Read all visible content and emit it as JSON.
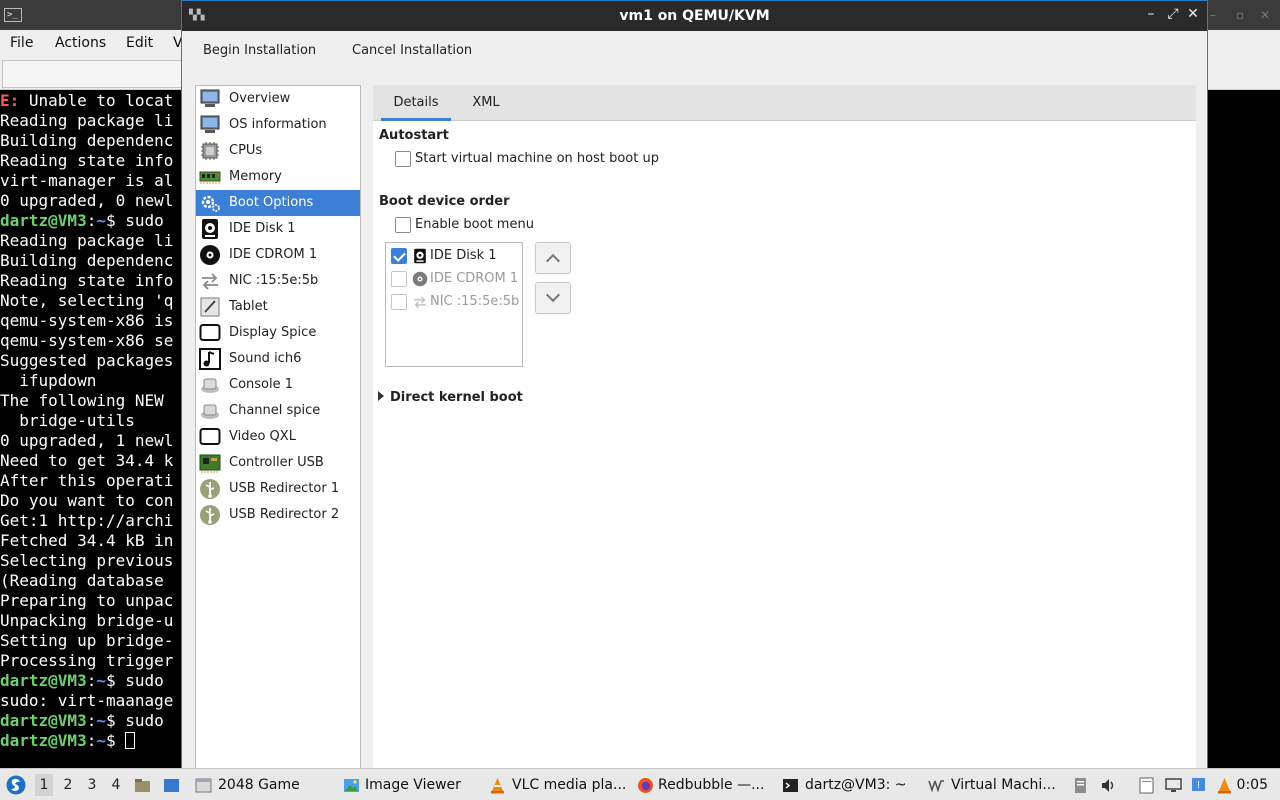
{
  "terminal": {
    "menu": [
      "File",
      "Actions",
      "Edit",
      "V"
    ],
    "lines": [
      [
        {
          "t": "E: ",
          "c": "red"
        },
        {
          "t": "Unable to locat"
        }
      ],
      [
        {
          "t": "Reading package li"
        }
      ],
      [
        {
          "t": "Building dependenc"
        }
      ],
      [
        {
          "t": "Reading state info"
        }
      ],
      [
        {
          "t": "virt-manager is al"
        }
      ],
      [
        {
          "t": "0 upgraded, 0 newl"
        }
      ],
      [
        {
          "t": "dartz@VM3",
          "c": "green"
        },
        {
          "t": ":"
        },
        {
          "t": "~",
          "c": "blue"
        },
        {
          "t": "$ sudo "
        }
      ],
      [
        {
          "t": "Reading package li"
        }
      ],
      [
        {
          "t": "Building dependenc"
        }
      ],
      [
        {
          "t": "Reading state info"
        }
      ],
      [
        {
          "t": "Note, selecting 'q"
        }
      ],
      [
        {
          "t": "qemu-system-x86 is"
        }
      ],
      [
        {
          "t": "qemu-system-x86 se"
        }
      ],
      [
        {
          "t": "Suggested packages"
        }
      ],
      [
        {
          "t": "  ifupdown"
        }
      ],
      [
        {
          "t": "The following NEW "
        }
      ],
      [
        {
          "t": "  bridge-utils"
        }
      ],
      [
        {
          "t": "0 upgraded, 1 newl"
        }
      ],
      [
        {
          "t": "Need to get 34.4 k"
        }
      ],
      [
        {
          "t": "After this operati"
        }
      ],
      [
        {
          "t": "Do you want to con"
        }
      ],
      [
        {
          "t": "Get:1 http://archi"
        }
      ],
      [
        {
          "t": "Fetched 34.4 kB in"
        }
      ],
      [
        {
          "t": "Selecting previous"
        }
      ],
      [
        {
          "t": "(Reading database "
        }
      ],
      [
        {
          "t": "Preparing to unpac"
        }
      ],
      [
        {
          "t": "Unpacking bridge-u"
        }
      ],
      [
        {
          "t": "Setting up bridge-"
        }
      ],
      [
        {
          "t": "Processing trigger"
        }
      ],
      [
        {
          "t": "dartz@VM3",
          "c": "green"
        },
        {
          "t": ":"
        },
        {
          "t": "~",
          "c": "blue"
        },
        {
          "t": "$ sudo "
        }
      ],
      [
        {
          "t": "sudo: virt-maanage"
        }
      ],
      [
        {
          "t": "dartz@VM3",
          "c": "green"
        },
        {
          "t": ":"
        },
        {
          "t": "~",
          "c": "blue"
        },
        {
          "t": "$ sudo "
        }
      ],
      [
        {
          "t": "dartz@VM3",
          "c": "green"
        },
        {
          "t": ":"
        },
        {
          "t": "~",
          "c": "blue"
        },
        {
          "t": "$ "
        },
        {
          "t": "",
          "c": "cursor"
        }
      ]
    ]
  },
  "vm_window": {
    "title": "vm1 on QEMU/KVM",
    "begin_install": "Begin Installation",
    "cancel_install": "Cancel Installation",
    "hardware": [
      {
        "label": "Overview",
        "icon": "monitor-icon"
      },
      {
        "label": "OS information",
        "icon": "monitor-icon"
      },
      {
        "label": "CPUs",
        "icon": "cpu-icon"
      },
      {
        "label": "Memory",
        "icon": "memory-icon"
      },
      {
        "label": "Boot Options",
        "icon": "gear-icon",
        "selected": true
      },
      {
        "label": "IDE Disk 1",
        "icon": "disk-icon"
      },
      {
        "label": "IDE CDROM 1",
        "icon": "cdrom-icon"
      },
      {
        "label": "NIC :15:5e:5b",
        "icon": "network-icon"
      },
      {
        "label": "Tablet",
        "icon": "tablet-icon"
      },
      {
        "label": "Display Spice",
        "icon": "display-icon"
      },
      {
        "label": "Sound ich6",
        "icon": "sound-icon"
      },
      {
        "label": "Console 1",
        "icon": "console-icon"
      },
      {
        "label": "Channel spice",
        "icon": "channel-icon"
      },
      {
        "label": "Video QXL",
        "icon": "display-icon"
      },
      {
        "label": "Controller USB",
        "icon": "controller-icon"
      },
      {
        "label": "USB Redirector 1",
        "icon": "usb-icon"
      },
      {
        "label": "USB Redirector 2",
        "icon": "usb-icon"
      }
    ],
    "tabs": {
      "details": "Details",
      "xml": "XML"
    },
    "autostart": {
      "title": "Autostart",
      "checkbox_label": "Start virtual machine on host boot up",
      "checked": false
    },
    "boot": {
      "title": "Boot device order",
      "menu_label": "Enable boot menu",
      "menu_checked": false,
      "devices": [
        {
          "label": "IDE Disk 1",
          "checked": true,
          "icon": "disk-icon"
        },
        {
          "label": "IDE CDROM 1",
          "checked": false,
          "icon": "cdrom-icon"
        },
        {
          "label": "NIC :15:5e:5b",
          "checked": false,
          "icon": "network-icon"
        }
      ]
    },
    "direct_kernel_boot": "Direct kernel boot"
  },
  "taskbar": {
    "workspaces": [
      "1",
      "2",
      "3",
      "4"
    ],
    "items": [
      {
        "label": "2048 Game",
        "icon": "window-icon"
      },
      {
        "label": "Image Viewer",
        "icon": "image-viewer-icon"
      },
      {
        "label": "VLC media pla...",
        "icon": "vlc-icon"
      },
      {
        "label": "Redbubble —...",
        "icon": "firefox-icon"
      },
      {
        "label": "dartz@VM3: ~",
        "icon": "terminal-icon"
      },
      {
        "label": "Virtual Machi...",
        "icon": "virt-manager-icon"
      }
    ],
    "clock": "0:05"
  },
  "colors": {
    "accent": "#3c7fd6",
    "titlebar": "#2a2a2a",
    "terminal_bg": "#000000"
  }
}
